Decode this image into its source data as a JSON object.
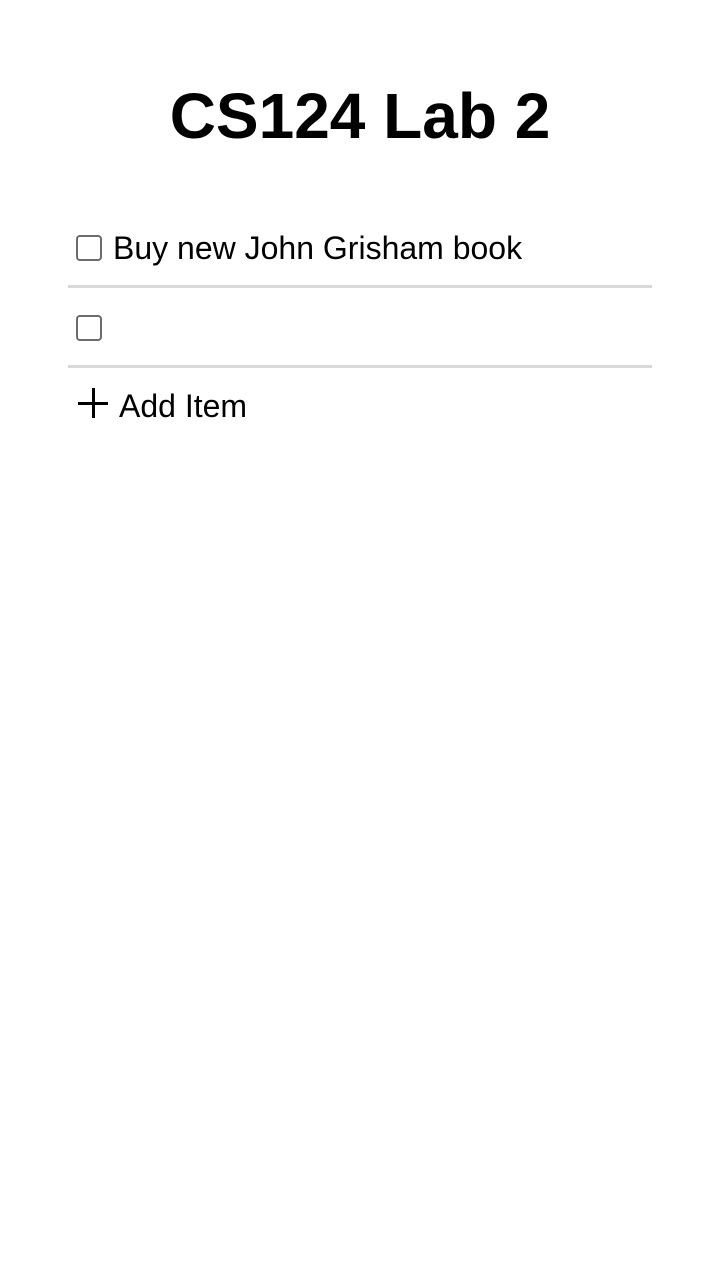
{
  "app": {
    "title": "CS124 Lab 2"
  },
  "todos": [
    {
      "text": "Buy new John Grisham book",
      "checked": false
    },
    {
      "text": "",
      "checked": false
    }
  ],
  "actions": {
    "add_item_label": "Add Item",
    "add_item_icon": "plus-icon"
  },
  "colors": {
    "divider": "#d9d9d9",
    "checkbox_border": "#6b6b6b",
    "text": "#000000",
    "background": "#ffffff"
  }
}
